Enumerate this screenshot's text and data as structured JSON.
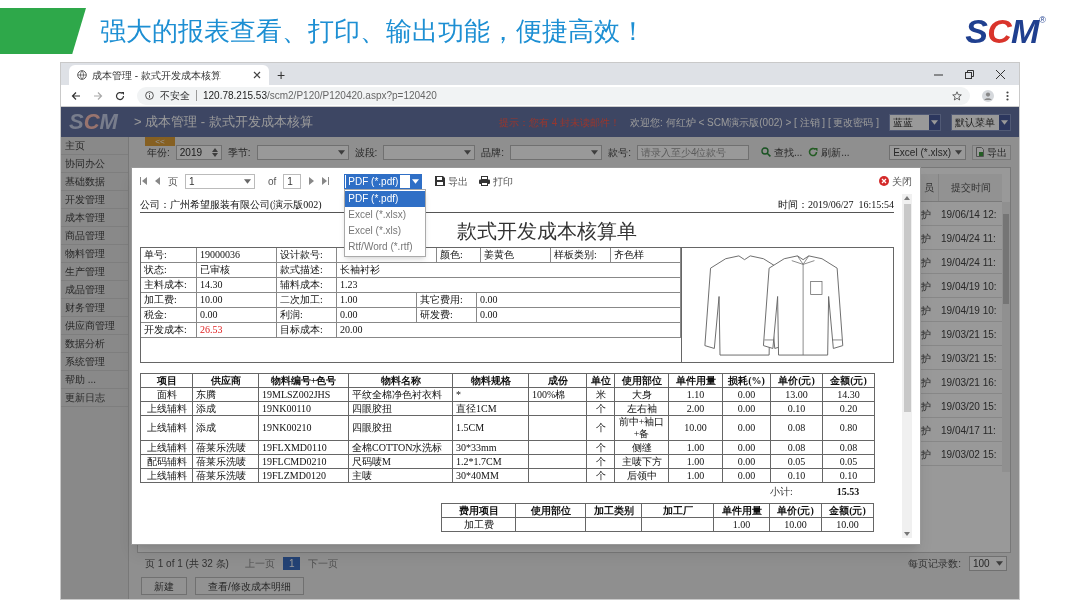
{
  "slide": {
    "title": "强大的报表查看、打印、输出功能，便捷高效！",
    "logo": "SCM",
    "logo_mark": "®"
  },
  "browser": {
    "tab_title": "成本管理 - 款式开发成本核算",
    "new_tab": "+",
    "security": "不安全",
    "url_host": "120.78.215.53",
    "url_path": "/scm2/P120/P120420.aspx?p=120420"
  },
  "app": {
    "logo": "SCM",
    "breadcrumb": "> 成本管理 - 款式开发成本核算",
    "collapse": "<<",
    "notice": "提示：您有 4 封未读邮件！",
    "welcome": "欢迎您: 何红炉 < SCM演示版(002) > [ 注销 ] [ 更改密码 ]",
    "theme": "蓝蓝",
    "menu": "默认菜单"
  },
  "sidebar": {
    "items": [
      "主页",
      "协同办公",
      "基础数据",
      "开发管理",
      "成本管理",
      "商品管理",
      "物料管理",
      "生产管理",
      "成品管理",
      "财务管理",
      "供应商管理",
      "数据分析",
      "系统管理",
      "帮助 ...",
      "更新日志"
    ]
  },
  "filters": [
    {
      "kind": "spin",
      "label": "年份:",
      "value": "2019"
    },
    {
      "kind": "select",
      "label": "季节:"
    },
    {
      "kind": "select",
      "label": "波段:"
    },
    {
      "kind": "select",
      "label": "品牌:"
    },
    {
      "kind": "text",
      "label": "款号:",
      "placeholder": "请录入至少4位款号"
    }
  ],
  "toolbar": {
    "search": "查找...",
    "refresh": "刷新...",
    "export_format": "Excel (*.xlsx)",
    "export": "导出"
  },
  "grid": {
    "columns": [
      "员",
      "提交时间"
    ],
    "rows": [
      [
        "护",
        "19/06/14 12:"
      ],
      [
        "护",
        "19/04/24 11:"
      ],
      [
        "护",
        "19/04/24 11:"
      ],
      [
        "护",
        "19/04/19 10:"
      ],
      [
        "护",
        "19/04/19 10:"
      ],
      [
        "护",
        "19/03/21 15:"
      ],
      [
        "护",
        "19/03/21 15:"
      ],
      [
        "护",
        "19/03/21 16:"
      ],
      [
        "护",
        "19/03/20 15:"
      ],
      [
        "护",
        "19/04/17 11:"
      ],
      [
        "护",
        "19/03/02 15:"
      ]
    ]
  },
  "pager": {
    "info": "页 1 of 1 (共 32 条)",
    "prev": "上一页",
    "pages": [
      {
        "label": "1",
        "selected": true
      }
    ],
    "next": "下一页",
    "page_size_label": "每页记录数:",
    "page_size": "100"
  },
  "actions": [
    "新建",
    "查看/修改成本明细"
  ],
  "modal": {
    "toolbar": {
      "page_label": "页",
      "page": "1",
      "of": "of",
      "total": "1",
      "format": "PDF (*.pdf)",
      "export": "导出",
      "print": "打印"
    },
    "close": "关闭",
    "format_options": [
      {
        "label": "PDF (*.pdf)",
        "selected": true
      },
      {
        "label": "Excel (*.xlsx)",
        "selected": false
      },
      {
        "label": "Excel (*.xls)",
        "selected": false
      },
      {
        "label": "Rtf/Word (*.rtf)",
        "selected": false
      }
    ],
    "report": {
      "company": "公司：广州希望服装有限公司(演示版002)",
      "time": "时间：2019/06/27  16:15:54",
      "title": "款式开发成本核算单",
      "fields": [
        [
          {
            "label": "单号:",
            "value": "19000036",
            "highlight": false
          },
          {
            "label": "设计款号:"
          },
          {
            "label": "颜色:",
            "value": "姜黄色",
            "highlight": false
          },
          {
            "label": "样板类别:",
            "value": "齐色样",
            "highlight": false
          }
        ],
        [
          {
            "label": "状态:",
            "value": "已审核",
            "highlight": false
          },
          {
            "label": "款式描述:",
            "value": "长袖衬衫",
            "highlight": false
          }
        ],
        [
          {
            "label": "主料成本:",
            "value": "14.30",
            "highlight": false
          },
          {
            "label": "辅料成本:",
            "value": "1.23",
            "highlight": false
          }
        ],
        [
          {
            "label": "加工费:",
            "value": "10.00",
            "highlight": false
          },
          {
            "label": "二次加工:",
            "value": "1.00",
            "highlight": false
          },
          {
            "label": "其它费用:",
            "value": "0.00",
            "highlight": false
          }
        ],
        [
          {
            "label": "税金:",
            "value": "0.00",
            "highlight": false
          },
          {
            "label": "利润:",
            "value": "0.00",
            "highlight": false
          },
          {
            "label": "研发费:",
            "value": "0.00",
            "highlight": false
          }
        ],
        [
          {
            "label": "开发成本:",
            "value": "26.53",
            "highlight": true
          },
          {
            "label": "目标成本:",
            "value": "20.00",
            "highlight": false
          }
        ]
      ],
      "materials": {
        "columns": [
          "项目",
          "供应商",
          "物料编号+色号",
          "物料名称",
          "物料规格",
          "成份",
          "单位",
          "使用部位",
          "单件用量",
          "损耗(%)",
          "单价(元)",
          "金额(元)"
        ],
        "rows": [
          [
            "面料",
            "东腾",
            "19MLSZ002JHS",
            "平纹全棉净色衬衣料",
            "*",
            "100%棉",
            "米",
            "大身",
            "1.10",
            "0.00",
            "13.00",
            "14.30"
          ],
          [
            "上线辅料",
            "添成",
            "19NK00110",
            "四眼胶扭",
            "直径1CM",
            null,
            "个",
            "左右袖",
            "2.00",
            "0.00",
            "0.10",
            "0.20"
          ],
          [
            "上线辅料",
            "添成",
            "19NK00210",
            "四眼胶扭",
            "1.5CM",
            null,
            "个",
            "前中+袖口+备",
            "10.00",
            "0.00",
            "0.08",
            "0.80"
          ],
          [
            "上线辅料",
            "蓓莱乐洗唛",
            "19FLXMD0110",
            "全棉COTTON水洗标",
            "30*33mm",
            null,
            "个",
            "侧缝",
            "1.00",
            "0.00",
            "0.08",
            "0.08"
          ],
          [
            "配码辅料",
            "蓓莱乐洗唛",
            "19FLCMD0210",
            "尺码唛M",
            "1.2*1.7CM",
            null,
            "个",
            "主唛下方",
            "1.00",
            "0.00",
            "0.05",
            "0.05"
          ],
          [
            "上线辅料",
            "蓓莱乐洗唛",
            "19FLZMD0120",
            "主唛",
            "30*40MM",
            null,
            "个",
            "后领中",
            "1.00",
            "0.00",
            "0.10",
            "0.10"
          ]
        ]
      },
      "subtotal_label": "小计:",
      "subtotal": "15.53",
      "fees": {
        "columns": [
          "费用项目",
          "使用部位",
          "加工类别",
          "加工厂",
          "单件用量",
          "单价(元)",
          "金额(元)"
        ],
        "rows": [
          [
            "加工费",
            null,
            null,
            null,
            "1.00",
            "10.00",
            "10.00"
          ]
        ]
      }
    }
  }
}
